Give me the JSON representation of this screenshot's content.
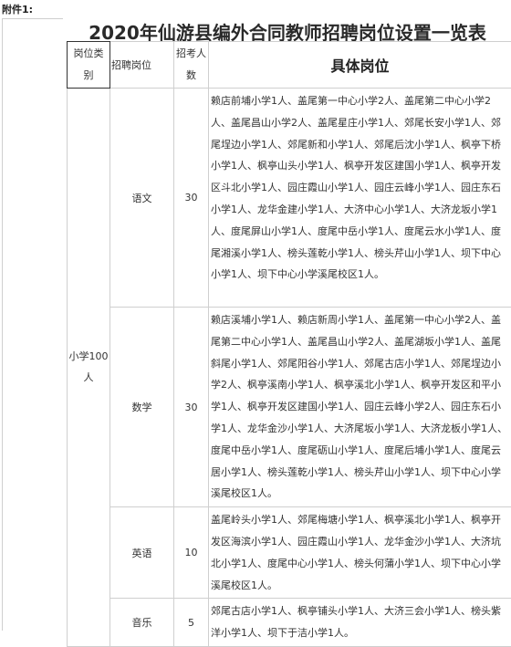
{
  "attachment_label": "附件1:",
  "title": "2020年仙游县编外合同教师招聘岗位设置一览表",
  "headers": {
    "category": [
      "岗位类",
      "别"
    ],
    "position": "招聘岗位",
    "count": [
      "招考人",
      "数"
    ],
    "detail": "具体岗位"
  },
  "category": {
    "name": "小学100",
    "unit": "人"
  },
  "rows": [
    {
      "position": "语文",
      "count": "30",
      "detail": "赖店前埔小学1人、盖尾第一中心小学2人、盖尾第二中心小学2人、盖尾昌山小学2人、盖尾星庄小学1人、郊尾长安小学1人、郊尾埕边小学1人、郊尾新和小学1人、郊尾后沈小学1人、枫亭下桥小学1人、枫亭山头小学1人、枫亭开发区建国小学1人、枫亭开发区斗北小学1人、园庄霞山小学1人、园庄云峰小学1人、园庄东石小学1人、龙华金建小学1人、大济中心小学1人、大济龙坂小学1人、度尾屏山小学1人、度尾中岳小学1人、度尾云水小学1人、度尾湘溪小学1人、榜头莲乾小学1人、榜头芹山小学1人、坝下中心小学1人、坝下中心小学溪尾校区1人。"
    },
    {
      "position": "数学",
      "count": "30",
      "detail": "赖店溪埔小学1人、赖店新周小学1人、盖尾第一中心小学2人、盖尾第二中心小学1人、盖尾昌山小学2人、盖尾湖坂小学1人、盖尾斜尾小学1人、郊尾阳谷小学1人、郊尾古店小学1人、郊尾埕边小学2人、枫亭溪南小学1人、枫亭溪北小学1人、枫亭开发区和平小学1人、枫亭开发区建国小学1人、园庄云峰小学2人、园庄东石小学1人、龙华金沙小学1人、大济尾坂小学1人、大济龙板小学1人、度尾中岳小学1人、度尾砺山小学1人、度尾后埔小学1人、度尾云居小学1人、榜头莲乾小学1人、榜头芹山小学1人、坝下中心小学溪尾校区1人。"
    },
    {
      "position": "英语",
      "count": "10",
      "detail": "盖尾岭头小学1人、郊尾梅塘小学1人、枫亭溪北小学1人、枫亭开发区海滨小学1人、园庄霞山小学1人、龙华金沙小学1人、大济坑北小学1人、度尾中心小学1人、榜头何蒲小学1人、坝下中心小学溪尾校区1人。"
    },
    {
      "position": "音乐",
      "count": "5",
      "detail": "郊尾古店小学1人、枫亭铺头小学1人、大济三会小学1人、榜头紫洋小学1人、坝下于洁小学1人。"
    }
  ]
}
